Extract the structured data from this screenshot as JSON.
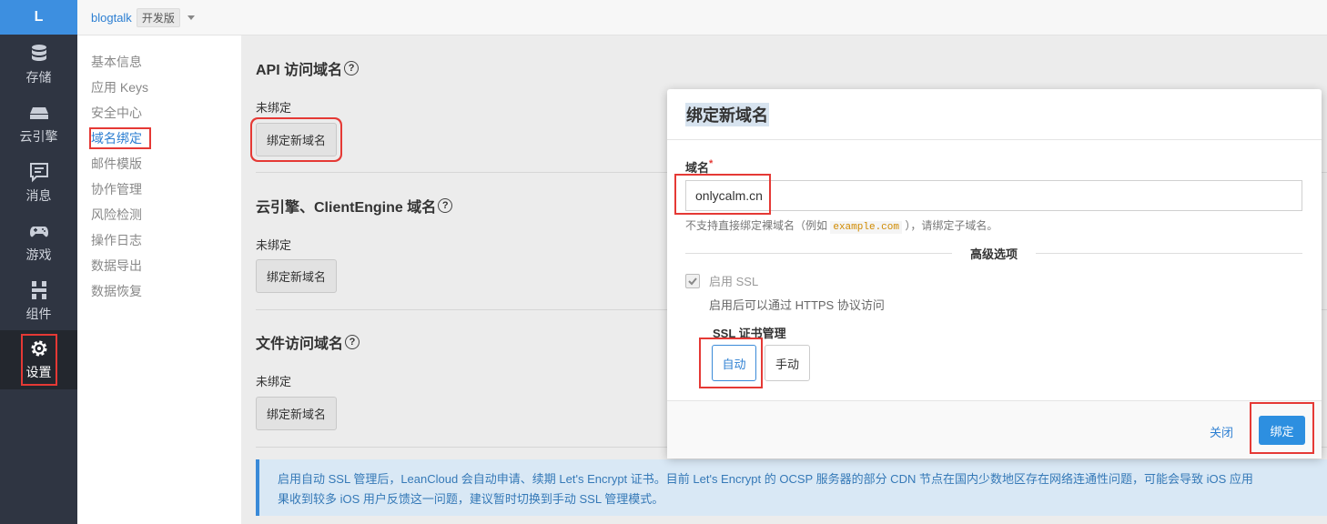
{
  "sidebar": {
    "logo": "L",
    "items": [
      {
        "label": "存储",
        "icon": "database-icon"
      },
      {
        "label": "云引擎",
        "icon": "server-icon"
      },
      {
        "label": "消息",
        "icon": "message-icon"
      },
      {
        "label": "游戏",
        "icon": "gamepad-icon"
      },
      {
        "label": "组件",
        "icon": "component-icon"
      },
      {
        "label": "设置",
        "icon": "gear-icon"
      }
    ]
  },
  "topbar": {
    "app_name": "blogtalk",
    "env_badge": "开发版"
  },
  "submenu": {
    "items": [
      "基本信息",
      "应用 Keys",
      "安全中心",
      "域名绑定",
      "邮件模版",
      "协作管理",
      "风险检测",
      "操作日志",
      "数据导出",
      "数据恢复"
    ]
  },
  "main": {
    "sections": [
      {
        "title": "API 访问域名",
        "status": "未绑定",
        "button": "绑定新域名"
      },
      {
        "title": "云引擎、ClientEngine 域名",
        "status": "未绑定",
        "button": "绑定新域名"
      },
      {
        "title": "文件访问域名",
        "status": "未绑定",
        "button": "绑定新域名"
      }
    ],
    "notice_line1": "启用自动 SSL 管理后，LeanCloud 会自动申请、续期 Let's Encrypt 证书。目前 Let's Encrypt 的 OCSP 服务器的部分 CDN 节点在国内少数地区存在网络连通性问题，可能会导致 iOS 应用",
    "notice_line2": "果收到较多 iOS 用户反馈这一问题，建议暂时切换到手动 SSL 管理模式。"
  },
  "modal": {
    "title": "绑定新域名",
    "field_label": "域名",
    "required_mark": "*",
    "domain_value": "onlycalm.cn",
    "help_prefix": "不支持直接绑定裸域名（例如",
    "help_code": "example.com",
    "help_suffix": "），请绑定子域名。",
    "advanced_label": "高级选项",
    "ssl_checkbox_label": "启用 SSL",
    "ssl_checked": true,
    "ssl_desc": "启用后可以通过 HTTPS 协议访问",
    "cert_label": "SSL 证书管理",
    "cert_auto": "自动",
    "cert_manual": "手动",
    "close": "关闭",
    "bind": "绑定"
  },
  "colors": {
    "accent": "#2d8fe0",
    "sidebar_bg": "#2f3542",
    "highlight": "#e53935"
  }
}
